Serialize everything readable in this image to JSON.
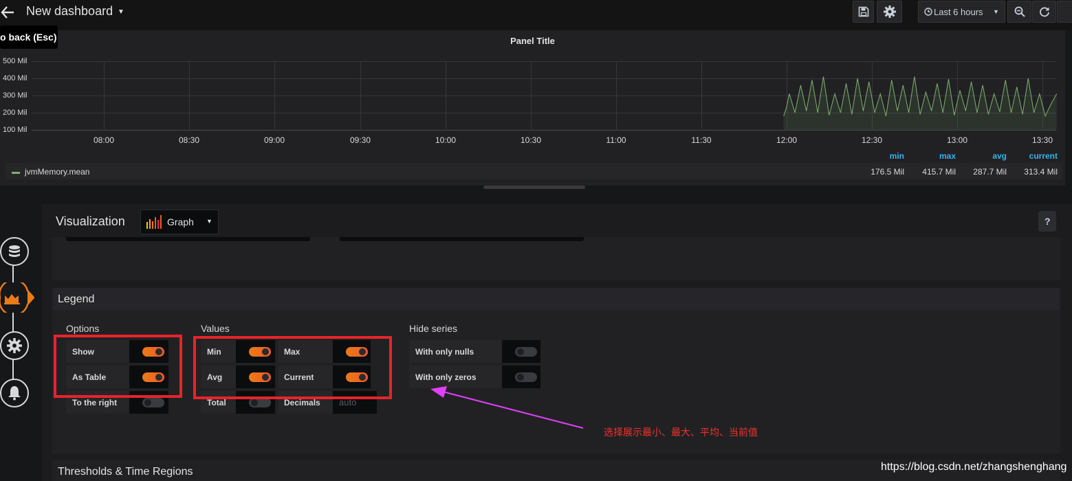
{
  "topbar": {
    "title": "New dashboard",
    "tooltip": "o back (Esc)",
    "time_range": "Last 6 hours",
    "icons": [
      "back-arrow-icon",
      "save-icon",
      "gear-icon",
      "clock-icon",
      "zoom-out-icon",
      "refresh-icon"
    ]
  },
  "panel": {
    "title": "Panel Title",
    "y_ticks": [
      "500 Mil",
      "400 Mil",
      "300 Mil",
      "200 Mil",
      "100 Mil"
    ],
    "x_ticks": [
      "08:00",
      "08:30",
      "09:00",
      "09:30",
      "10:00",
      "10:30",
      "11:00",
      "11:30",
      "12:00",
      "12:30",
      "13:00",
      "13:30"
    ],
    "legend": {
      "headers": [
        "min",
        "max",
        "avg",
        "current"
      ],
      "series_name": "jvmMemory.mean",
      "series_color": "#7eb26d",
      "values": [
        "176.5 Mil",
        "415.7 Mil",
        "287.7 Mil",
        "313.4 Mil"
      ]
    }
  },
  "chart_data": {
    "type": "line",
    "ylabel": "",
    "xlabel": "",
    "x_range": [
      "07:50",
      "13:35"
    ],
    "y_ticks_values": [
      100,
      200,
      300,
      400,
      500
    ],
    "ylim": [
      100,
      500
    ],
    "y_unit": "Mil",
    "series": [
      {
        "name": "jvmMemory.mean",
        "color": "#7eb26d",
        "x": [
          "11:59",
          "12:00",
          "12:01",
          "12:03",
          "12:05",
          "12:07",
          "12:09",
          "12:11",
          "12:13",
          "12:15",
          "12:17",
          "12:19",
          "12:21",
          "12:23",
          "12:25",
          "12:27",
          "12:29",
          "12:31",
          "12:33",
          "12:35",
          "12:37",
          "12:39",
          "12:41",
          "12:43",
          "12:45",
          "12:47",
          "12:49",
          "12:51",
          "12:53",
          "12:55",
          "12:57",
          "12:59",
          "13:01",
          "13:03",
          "13:05",
          "13:07",
          "13:09",
          "13:11",
          "13:13",
          "13:15",
          "13:17",
          "13:19",
          "13:21",
          "13:23",
          "13:25",
          "13:27",
          "13:29",
          "13:31",
          "13:33",
          "13:35"
        ],
        "values": [
          180,
          230,
          310,
          200,
          360,
          210,
          390,
          200,
          410,
          185,
          310,
          200,
          370,
          190,
          400,
          210,
          380,
          200,
          310,
          180,
          390,
          210,
          360,
          200,
          410,
          190,
          320,
          210,
          370,
          200,
          395,
          185,
          330,
          210,
          380,
          200,
          360,
          190,
          310,
          205,
          390,
          200,
          350,
          190,
          400,
          200,
          310,
          180,
          250,
          310
        ]
      }
    ],
    "legend": {
      "placement": "bottom",
      "as_table": true,
      "values": [
        "min",
        "max",
        "avg",
        "current"
      ]
    },
    "grid": true
  },
  "editor": {
    "visualization_label": "Visualization",
    "visualization_value": "Graph",
    "help_label": "?",
    "legend_section": {
      "title": "Legend",
      "options": {
        "title": "Options",
        "items": [
          {
            "label": "Show",
            "on": true
          },
          {
            "label": "As Table",
            "on": true
          },
          {
            "label": "To the right",
            "on": false
          }
        ]
      },
      "values": {
        "title": "Values",
        "items": [
          {
            "label": "Min",
            "on": true
          },
          {
            "label": "Max",
            "on": true
          },
          {
            "label": "Avg",
            "on": true
          },
          {
            "label": "Current",
            "on": true
          },
          {
            "label": "Total",
            "on": false
          },
          {
            "label": "Decimals",
            "placeholder": "auto"
          }
        ]
      },
      "hide_series": {
        "title": "Hide series",
        "items": [
          {
            "label": "With only nulls",
            "on": false
          },
          {
            "label": "With only zeros",
            "on": false
          }
        ]
      }
    },
    "next_section_title": "Thresholds & Time Regions"
  },
  "annotation": {
    "text": "选择展示最小、最大、平均、当前值",
    "color": "#f0322b"
  },
  "watermark": "https://blog.csdn.net/zhangshenghang",
  "colors": {
    "accent": "#eb7b18",
    "legend_header": "#33b5e5",
    "annotation_box": "#e8232b",
    "arrow": "#e040fb"
  }
}
